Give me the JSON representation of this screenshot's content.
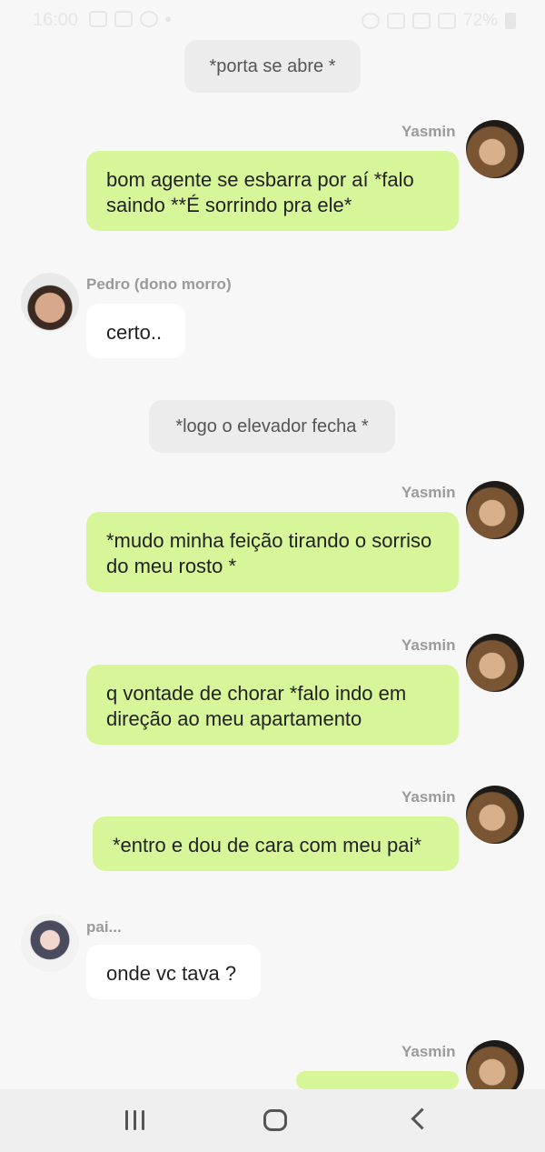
{
  "status_bar": {
    "time": "16:00",
    "battery": "72%"
  },
  "messages": {
    "sys1": "*porta se abre *",
    "yasmin_name": "Yasmin",
    "msg1": "bom  agente se esbarra por aí *falo saindo **É sorrindo pra ele*",
    "pedro_name": "Pedro (dono morro)",
    "msg2": "certo..",
    "sys2": "*logo o elevador fecha *",
    "msg3": "*mudo minha  feição tirando o sorriso do meu rosto *",
    "msg4": "q vontade de chorar *falo indo em direção ao meu apartamento",
    "msg5": "*entro e dou de cara com meu pai*",
    "pai_name": "pai...",
    "msg6": "onde vc tava ?"
  },
  "icons": {
    "nav_recents": "recents-icon",
    "nav_home": "home-icon",
    "nav_back": "back-icon"
  }
}
